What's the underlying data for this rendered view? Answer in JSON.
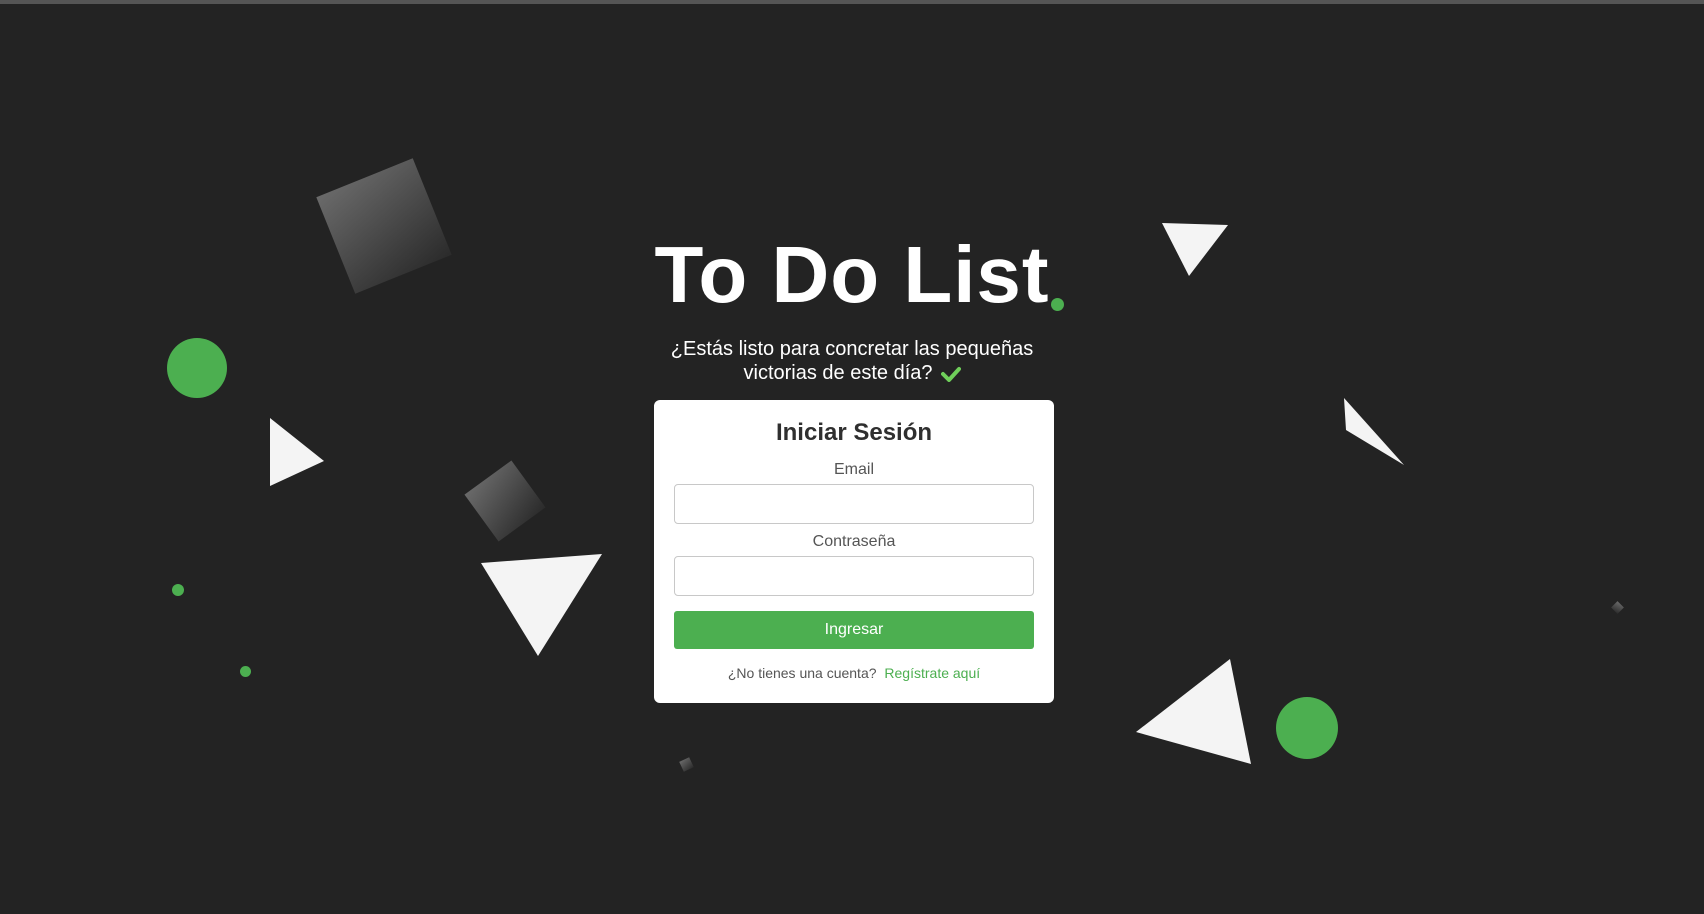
{
  "colors": {
    "background": "#232323",
    "accent_green": "#4caf50",
    "triangle_white": "#f4f4f4",
    "card_background": "#ffffff"
  },
  "header": {
    "title": "To Do List",
    "subtitle": "¿Estás listo para concretar las pequeñas victorias de este día?",
    "subtitle_icon": "check-icon"
  },
  "login": {
    "title": "Iniciar Sesión",
    "email_label": "Email",
    "email_value": "",
    "password_label": "Contraseña",
    "password_value": "",
    "submit_label": "Ingresar",
    "register_prompt": "¿No tienes una cuenta?",
    "register_link": "Regístrate aquí"
  }
}
